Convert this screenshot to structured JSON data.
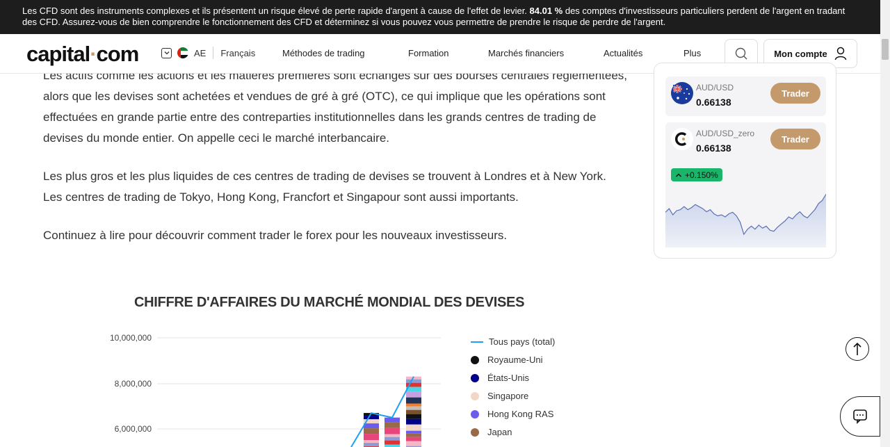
{
  "banner": {
    "text_before": "Les CFD sont des instruments complexes et ils présentent un risque élevé de perte rapide d'argent à cause de l'effet de levier. ",
    "percent": "84.01 %",
    "text_after": " des comptes d'investisseurs particuliers perdent de l'argent en tradant des CFD. Assurez-vous de bien comprendre le fonctionnement des CFD et déterminez si vous pouvez vous permettre de prendre le risque de perdre de l'argent."
  },
  "header": {
    "logo_left": "capital",
    "logo_dot": "·",
    "logo_right": "com",
    "region_code": "AE",
    "language": "Français",
    "nav": [
      "Méthodes de trading",
      "Formation",
      "Marchés financiers",
      "Actualités",
      "Plus"
    ],
    "account_label": "Mon compte"
  },
  "article": {
    "paragraphs": [
      "Les actifs comme les actions et les matières premières sont échangés sur des bourses centrales réglementées, alors que les devises sont achetées et vendues de gré à gré (OTC), ce qui implique que les opérations sont effectuées en grande partie entre des contreparties institutionnelles dans les grands centres de trading de devises du monde entier. On appelle ceci le marché interbancaire.",
      "Les plus gros et les plus liquides de ces centres de trading de devises se trouvent à Londres et à New York. Les centres de trading de Tokyo, Hong Kong, Francfort et Singapour sont aussi importants.",
      "Continuez à lire pour découvrir comment trader le forex pour les nouveaux investisseurs."
    ]
  },
  "widget": {
    "items": [
      {
        "symbol": "AUD/USD",
        "price": "0.66138",
        "button": "Trader"
      },
      {
        "symbol": "AUD/USD_zero",
        "price": "0.66138",
        "button": "Trader",
        "change": "+0.150%"
      }
    ],
    "sparkline": [
      0.55,
      0.62,
      0.5,
      0.58,
      0.6,
      0.66,
      0.6,
      0.64,
      0.7,
      0.66,
      0.62,
      0.56,
      0.6,
      0.52,
      0.48,
      0.5,
      0.46,
      0.52,
      0.55,
      0.48,
      0.36,
      0.12,
      0.22,
      0.28,
      0.22,
      0.3,
      0.24,
      0.28,
      0.2,
      0.18,
      0.26,
      0.32,
      0.38,
      0.46,
      0.42,
      0.5,
      0.56,
      0.48,
      0.44,
      0.52,
      0.6,
      0.72,
      0.78,
      0.9
    ],
    "colors": {
      "up": "#1ab56a",
      "button": "#c49a6c"
    }
  },
  "chart_data": {
    "type": "bar",
    "title": "CHIFFRE D'AFFAIRES DU MARCHÉ MONDIAL DES DEVISES",
    "yticks": [
      "10,000,000",
      "8,000,000",
      "6,000,000"
    ],
    "ylim": [
      5000000,
      10000000
    ],
    "stack_totals": [
      6700000,
      6500000,
      8300000
    ],
    "line_series": [
      5200000,
      6700000,
      6500000,
      8300000
    ],
    "legend": [
      {
        "label": "Tous pays (total)",
        "color": "#1ea0f0",
        "kind": "line"
      },
      {
        "label": "Royaume-Uni",
        "color": "#111111",
        "kind": "dot"
      },
      {
        "label": "États-Unis",
        "color": "#00008b",
        "kind": "dot"
      },
      {
        "label": "Singapore",
        "color": "#f2d7c8",
        "kind": "dot"
      },
      {
        "label": "Hong Kong RAS",
        "color": "#6b5cf0",
        "kind": "dot"
      },
      {
        "label": "Japan",
        "color": "#9a6a48",
        "kind": "dot"
      }
    ]
  }
}
